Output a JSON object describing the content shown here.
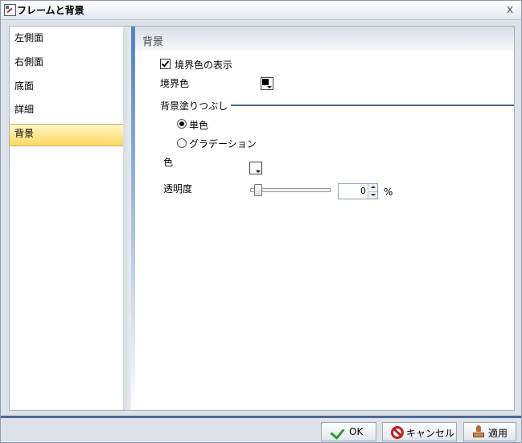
{
  "window": {
    "title": "フレームと背景",
    "close_label": "x"
  },
  "sidebar": {
    "items": [
      {
        "label": "左側面",
        "selected": false
      },
      {
        "label": "右側面",
        "selected": false
      },
      {
        "label": "底面",
        "selected": false
      },
      {
        "label": "詳細",
        "selected": false
      },
      {
        "label": "背景",
        "selected": true
      }
    ]
  },
  "panel": {
    "header": "背景",
    "show_border": {
      "label": "境界色の表示",
      "checked": true
    },
    "border_color": {
      "label": "境界色",
      "value": "#000000"
    },
    "fill_section": {
      "label": "背景塗りつぶし"
    },
    "fill_options": [
      {
        "label": "単色",
        "selected": true
      },
      {
        "label": "グラデーション",
        "selected": false
      }
    ],
    "color": {
      "label": "色",
      "value": "#ffffff"
    },
    "transparency": {
      "label": "透明度",
      "value": "0",
      "unit": "%",
      "level": 0
    }
  },
  "footer": {
    "ok_label": "OK",
    "cancel_label": "キャンセル",
    "apply_label": "適用"
  },
  "colors": {
    "accent": "#4a6a96",
    "selected_bg": "#ffd860"
  }
}
